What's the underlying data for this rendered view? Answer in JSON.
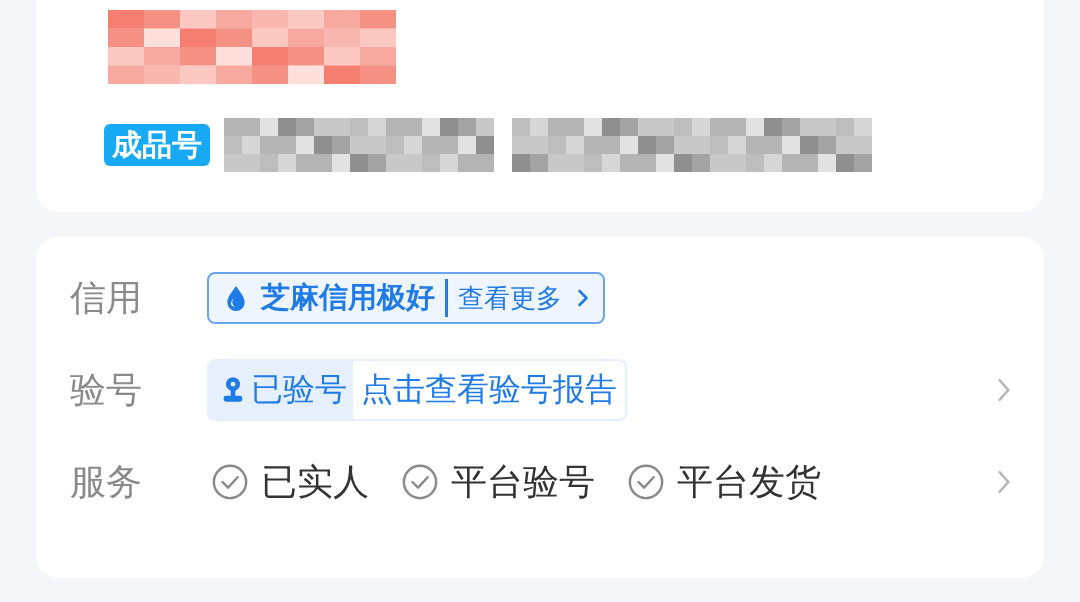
{
  "product": {
    "badge": "成品号"
  },
  "details": [
    {
      "kind": "credit",
      "label": "信用",
      "title": "芝麻信用极好",
      "link": "查看更多",
      "chevron": false
    },
    {
      "kind": "verify",
      "label": "验号",
      "status": "已验号",
      "link": "点击查看验号报告",
      "chevron": true
    },
    {
      "kind": "services",
      "label": "服务",
      "items": [
        "已实人",
        "平台验号",
        "平台发货"
      ],
      "chevron": true
    }
  ]
}
